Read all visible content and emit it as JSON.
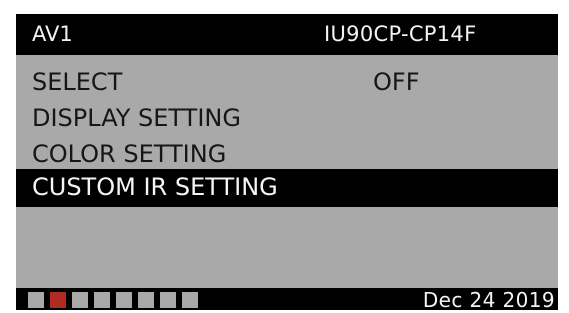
{
  "header": {
    "source": "AV1",
    "model": "IU90CP-CP14F"
  },
  "menu": {
    "items": [
      {
        "label": "SELECT",
        "value": "OFF",
        "selected": false
      },
      {
        "label": "DISPLAY SETTING",
        "value": "",
        "selected": false
      },
      {
        "label": "COLOR SETTING",
        "value": "",
        "selected": false
      },
      {
        "label": "CUSTOM IR SETTING",
        "value": "",
        "selected": true
      }
    ]
  },
  "footer": {
    "pages": {
      "count": 8,
      "active_index": 1
    },
    "date": "Dec 24 2019"
  },
  "colors": {
    "screen_background": "#000000",
    "menu_background": "#a9a9a9",
    "menu_text": "#161616",
    "selection_background": "#000000",
    "selection_text": "#f5f5f5",
    "page_indicator_inactive": "#a8a8a8",
    "page_indicator_active": "#b02c23"
  }
}
